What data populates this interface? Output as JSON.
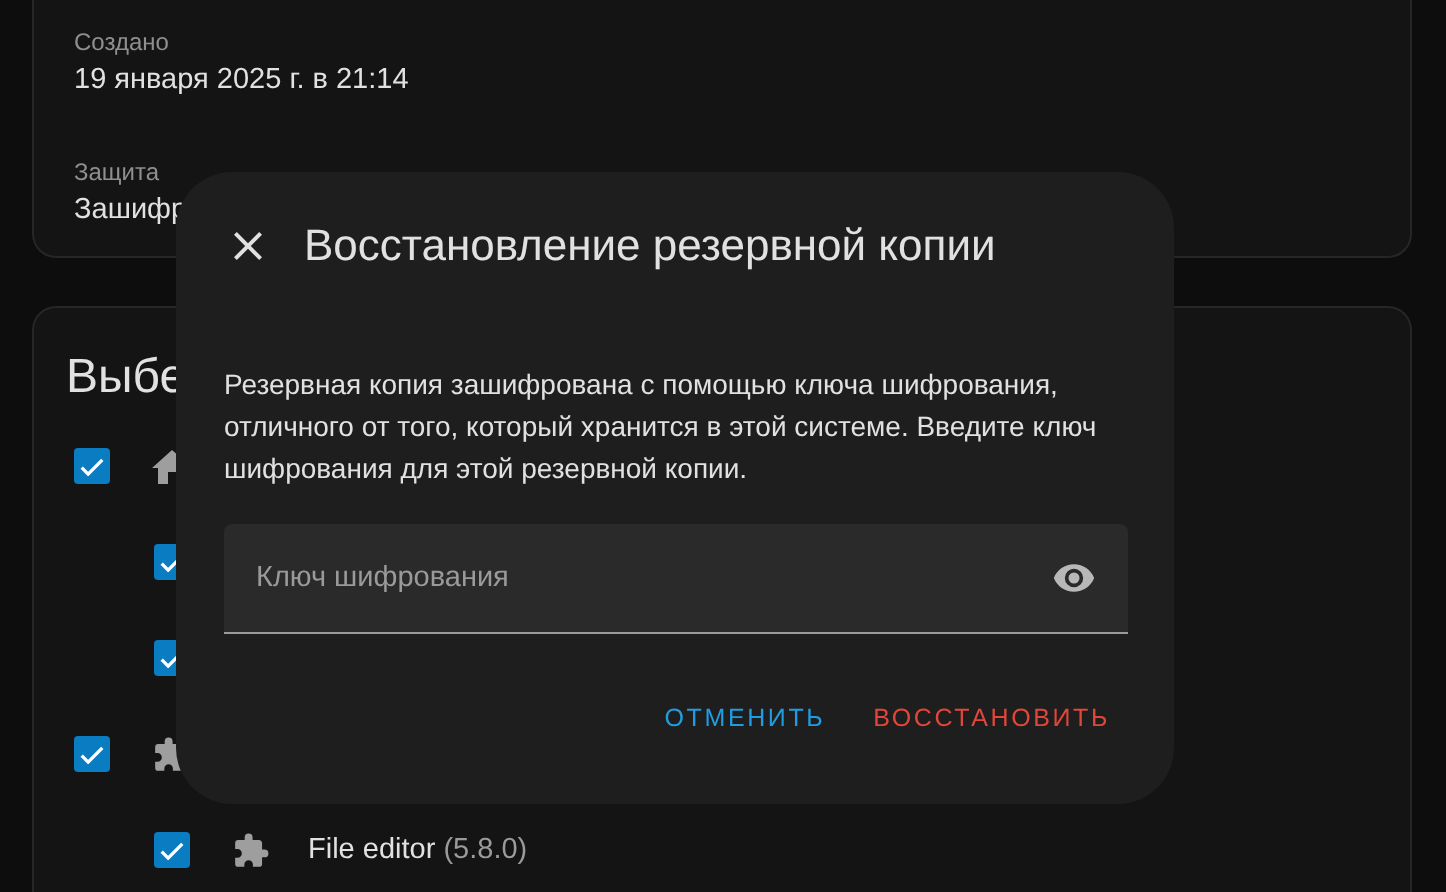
{
  "details": {
    "fields": [
      {
        "label": "Создано",
        "value": "19 января 2025 г. в 21:14"
      },
      {
        "label": "Защита",
        "value": "Зашифр"
      }
    ]
  },
  "selection": {
    "title": "Выбе",
    "items": [
      {
        "kind": "system",
        "checked": true,
        "children": [
          {
            "checked": true
          },
          {
            "checked": true
          }
        ]
      },
      {
        "kind": "addon",
        "checked": true,
        "children": [
          {
            "kind": "addon",
            "checked": true,
            "name": "File editor",
            "version": "(5.8.0)"
          }
        ]
      }
    ]
  },
  "dialog": {
    "title": "Восстановление резервной копии",
    "message": "Резервная копия зашифрована с помощью ключа шифрования, отличного от того, который хранится в этой системе. Введите ключ шифрования для этой резервной копии.",
    "field": {
      "placeholder": "Ключ шифрования"
    },
    "buttons": [
      {
        "label": "ОТМЕНИТЬ",
        "kind": "cancel"
      },
      {
        "label": "ВОССТАНОВИТЬ",
        "kind": "confirm"
      }
    ]
  }
}
